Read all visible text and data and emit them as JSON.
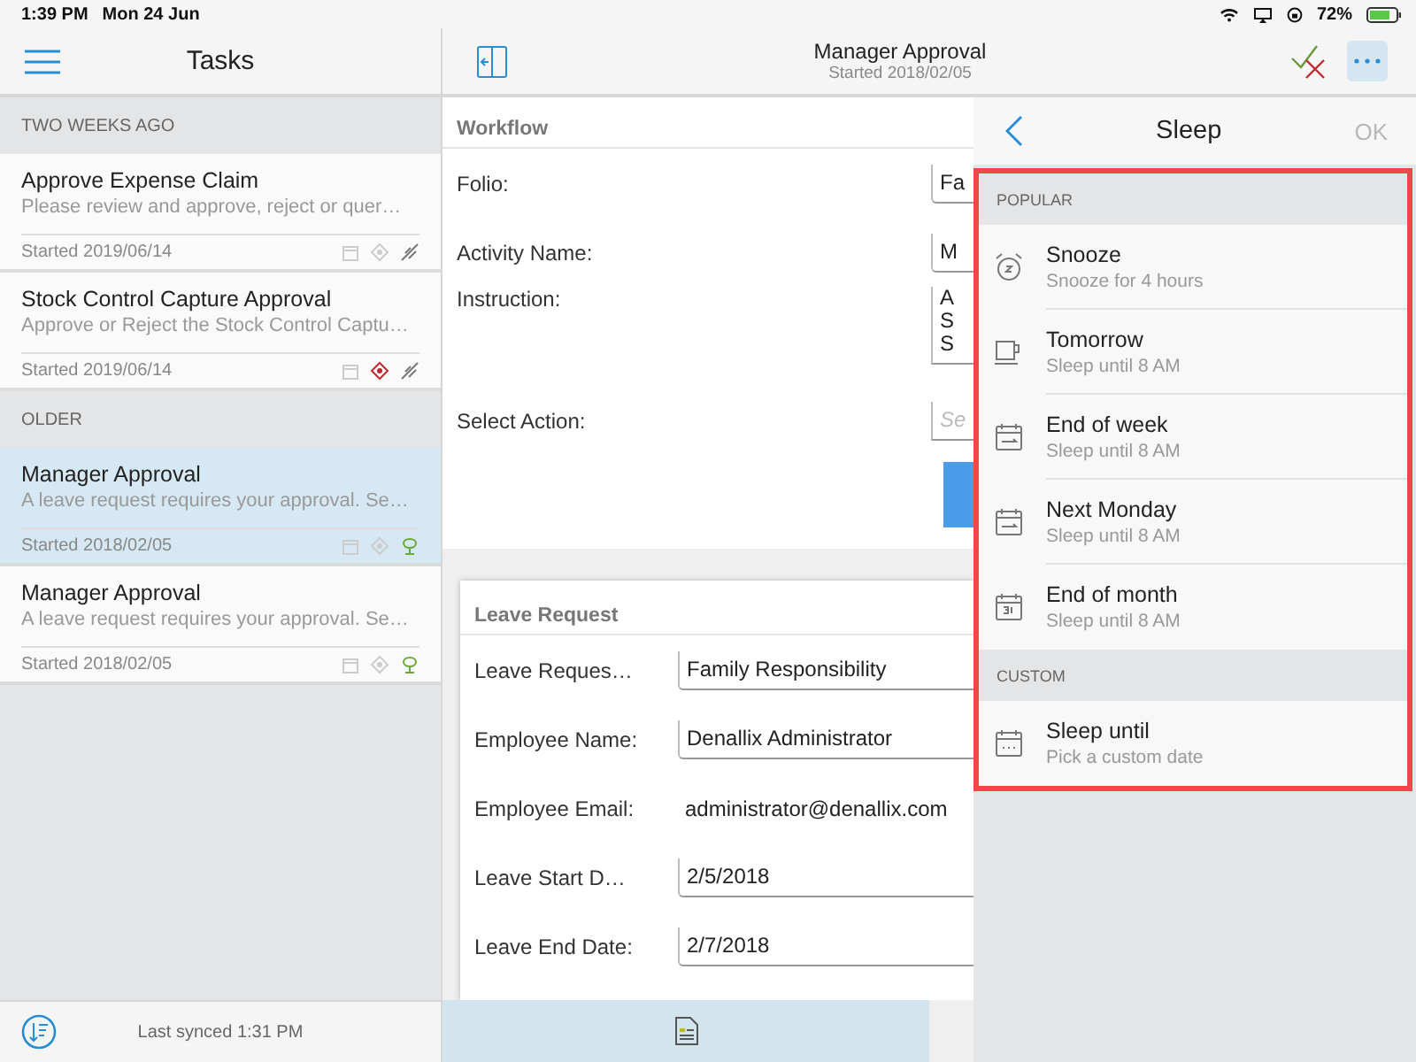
{
  "status_bar": {
    "time": "1:39 PM",
    "date": "Mon 24 Jun",
    "battery": "72%"
  },
  "task_list": {
    "title": "Tasks",
    "groups": [
      {
        "heading": "TWO WEEKS AGO",
        "tasks": [
          {
            "title": "Approve Expense Claim",
            "description": "Please review and approve, reject or quer…",
            "started": "Started 2019/06/14",
            "selected": false,
            "flagged": false,
            "synced": false
          },
          {
            "title": "Stock Control Capture Approval",
            "description": "Approve or Reject the Stock Control Captu…",
            "started": "Started 2019/06/14",
            "selected": false,
            "flagged": true,
            "synced": false
          }
        ]
      },
      {
        "heading": "OLDER",
        "tasks": [
          {
            "title": "Manager Approval",
            "description": "A leave request requires your approval. Se…",
            "started": "Started 2018/02/05",
            "selected": true,
            "flagged": false,
            "synced": true
          },
          {
            "title": "Manager Approval",
            "description": "A leave request requires your approval. Se…",
            "started": "Started 2018/02/05",
            "selected": false,
            "flagged": false,
            "synced": true
          }
        ]
      }
    ],
    "footer": "Last synced 1:31 PM"
  },
  "task_header": {
    "title": "Manager Approval",
    "subtitle": "Started 2018/02/05"
  },
  "workflow": {
    "heading": "Workflow",
    "fields": [
      {
        "label": "Folio:",
        "kind": "input",
        "value": "Fa"
      },
      {
        "label": "Activity Name:",
        "kind": "input",
        "value": "M"
      },
      {
        "label": "Instruction:",
        "kind": "multiline",
        "lines": [
          "A",
          "S",
          "S"
        ]
      },
      {
        "label": "Select Action:",
        "kind": "select",
        "placeholder": "Se"
      }
    ]
  },
  "leave_request": {
    "heading": "Leave Request",
    "fields": [
      {
        "label": "Leave Reques…",
        "kind": "input",
        "value": "Family Responsibility"
      },
      {
        "label": "Employee Name:",
        "kind": "input",
        "value": "Denallix Administrator"
      },
      {
        "label": "Employee Email:",
        "kind": "text",
        "value": "administrator@denallix.com"
      },
      {
        "label": "Leave Start D…",
        "kind": "input",
        "value": "2/5/2018"
      },
      {
        "label": "Leave End Date:",
        "kind": "input",
        "value": "2/7/2018"
      }
    ]
  },
  "sleep_panel": {
    "title": "Sleep",
    "ok": {
      "label": "OK",
      "disabled": true
    },
    "sections": [
      {
        "heading": "POPULAR",
        "options": [
          {
            "kind": "alarm",
            "title": "Snooze",
            "subtitle": "Snooze for 4 hours"
          },
          {
            "kind": "cup",
            "title": "Tomorrow",
            "subtitle": "Sleep until 8 AM"
          },
          {
            "kind": "calendar-arrow",
            "title": "End of week",
            "subtitle": "Sleep until 8 AM"
          },
          {
            "kind": "calendar-arrow",
            "title": "Next Monday",
            "subtitle": "Sleep until 8 AM"
          },
          {
            "kind": "calendar-31",
            "title": "End of month",
            "subtitle": "Sleep until 8 AM"
          }
        ]
      },
      {
        "heading": "CUSTOM",
        "options": [
          {
            "kind": "calendar-dots",
            "title": "Sleep until",
            "subtitle": "Pick a custom date"
          }
        ]
      }
    ]
  }
}
